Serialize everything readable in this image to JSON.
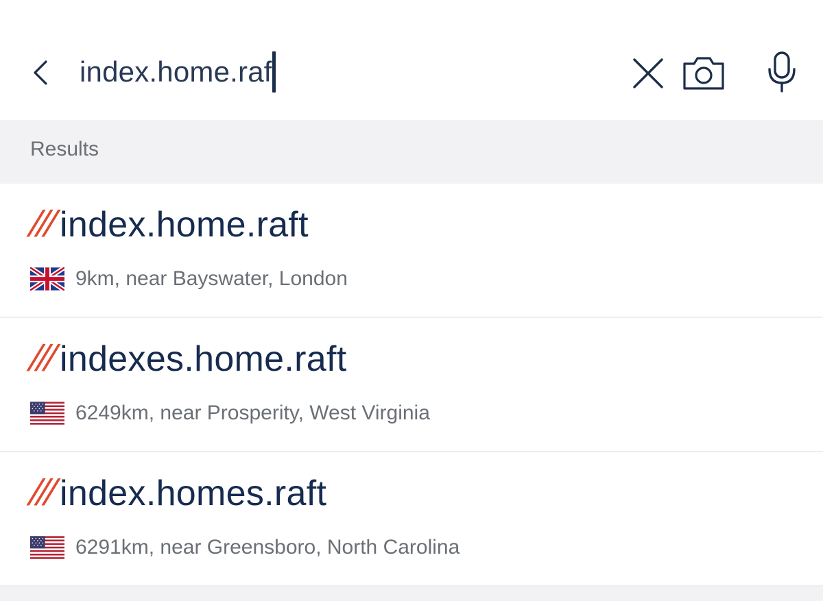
{
  "search": {
    "query": "index.home.raf",
    "back_icon": "chevron-left-icon",
    "clear_icon": "close-icon",
    "camera_icon": "camera-icon",
    "mic_icon": "microphone-icon"
  },
  "results": {
    "header": "Results",
    "slashes": "///",
    "items": [
      {
        "words": "index.home.raft",
        "flag": "uk-flag-icon",
        "detail": "9km, near Bayswater, London"
      },
      {
        "words": "indexes.home.raft",
        "flag": "us-flag-icon",
        "detail": "6249km, near Prosperity, West Virginia"
      },
      {
        "words": "index.homes.raft",
        "flag": "us-flag-icon",
        "detail": "6291km, near Greensboro, North Carolina"
      }
    ]
  },
  "colors": {
    "accent_slashes": "#e04a2f",
    "text_primary": "#162b4f",
    "text_secondary": "#6b6f76",
    "header_bg": "#f2f2f4"
  }
}
